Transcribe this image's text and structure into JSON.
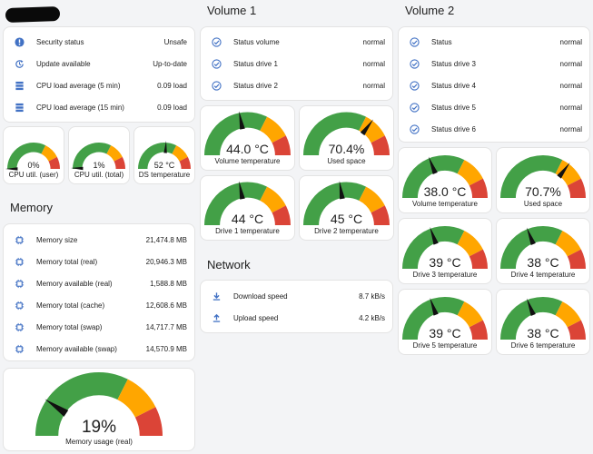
{
  "colors": {
    "green": "#43a047",
    "yellow": "#ffa600",
    "red": "#db4437",
    "icon": "#4171c4",
    "needle": "#111111"
  },
  "system": {
    "rows": [
      {
        "icon": "alert-circle-icon",
        "label": "Security status",
        "value": "Unsafe"
      },
      {
        "icon": "update-icon",
        "label": "Update available",
        "value": "Up-to-date"
      },
      {
        "icon": "server-icon",
        "label": "CPU load average (5 min)",
        "value": "0.09 load"
      },
      {
        "icon": "server-icon",
        "label": "CPU load average (15 min)",
        "value": "0.09 load"
      }
    ],
    "gauges": [
      {
        "value": "0%",
        "label": "CPU util. (user)",
        "level": 0.0
      },
      {
        "value": "1%",
        "label": "CPU util. (total)",
        "level": 0.01
      },
      {
        "value": "52 °C",
        "label": "DS temperature",
        "level": 0.52
      }
    ]
  },
  "memory": {
    "heading": "Memory",
    "rows": [
      {
        "label": "Memory size",
        "value": "21,474.8 MB"
      },
      {
        "label": "Memory total (real)",
        "value": "20,946.3 MB"
      },
      {
        "label": "Memory available (real)",
        "value": "1,588.8 MB"
      },
      {
        "label": "Memory total (cache)",
        "value": "12,608.6 MB"
      },
      {
        "label": "Memory total (swap)",
        "value": "14,717.7 MB"
      },
      {
        "label": "Memory available (swap)",
        "value": "14,570.9 MB"
      }
    ],
    "gauge": {
      "value": "19%",
      "label": "Memory usage (real)",
      "level": 0.19
    }
  },
  "volume1": {
    "heading": "Volume 1",
    "rows": [
      {
        "label": "Status volume",
        "value": "normal"
      },
      {
        "label": "Status drive 1",
        "value": "normal"
      },
      {
        "label": "Status drive 2",
        "value": "normal"
      }
    ],
    "gauges": [
      {
        "value": "44.0 °C",
        "label": "Volume temperature",
        "level": 0.44
      },
      {
        "value": "70.4%",
        "label": "Used space",
        "level": 0.704
      },
      {
        "value": "44 °C",
        "label": "Drive 1 temperature",
        "level": 0.44
      },
      {
        "value": "45 °C",
        "label": "Drive 2 temperature",
        "level": 0.45
      }
    ]
  },
  "network": {
    "heading": "Network",
    "rows": [
      {
        "icon": "download-icon",
        "label": "Download speed",
        "value": "8.7 kB/s"
      },
      {
        "icon": "upload-icon",
        "label": "Upload speed",
        "value": "4.2 kB/s"
      }
    ]
  },
  "volume2": {
    "heading": "Volume 2",
    "rows": [
      {
        "label": "Status",
        "value": "normal"
      },
      {
        "label": "Status drive 3",
        "value": "normal"
      },
      {
        "label": "Status drive 4",
        "value": "normal"
      },
      {
        "label": "Status drive 5",
        "value": "normal"
      },
      {
        "label": "Status drive 6",
        "value": "normal"
      }
    ],
    "gauges": [
      {
        "value": "38.0 °C",
        "label": "Volume temperature",
        "level": 0.38
      },
      {
        "value": "70.7%",
        "label": "Used space",
        "level": 0.707
      },
      {
        "value": "39 °C",
        "label": "Drive 3 temperature",
        "level": 0.39
      },
      {
        "value": "38 °C",
        "label": "Drive 4 temperature",
        "level": 0.38
      },
      {
        "value": "39 °C",
        "label": "Drive 5 temperature",
        "level": 0.39
      },
      {
        "value": "38 °C",
        "label": "Drive 6 temperature",
        "level": 0.38
      }
    ]
  }
}
